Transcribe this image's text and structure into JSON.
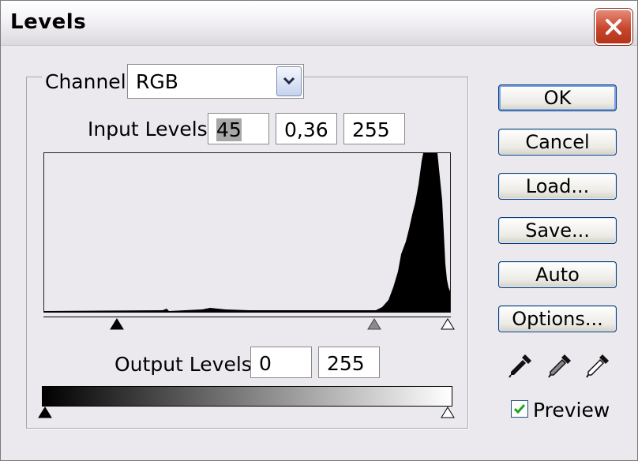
{
  "window": {
    "title": "Levels"
  },
  "channel": {
    "label": "Channel:",
    "value": "RGB"
  },
  "input_levels": {
    "label": "Input Levels:",
    "black": "45",
    "gamma": "0,36",
    "white": "255"
  },
  "output_levels": {
    "label": "Output Levels:",
    "black": "0",
    "white": "255"
  },
  "buttons": {
    "ok": "OK",
    "cancel": "Cancel",
    "load": "Load...",
    "save": "Save...",
    "auto": "Auto",
    "options": "Options..."
  },
  "preview": {
    "label": "Preview",
    "checked": true
  },
  "icons": [
    "close-icon",
    "dropdown-arrow-icon",
    "black-eyedropper-icon",
    "gray-eyedropper-icon",
    "white-eyedropper-icon",
    "checkmark-icon"
  ]
}
